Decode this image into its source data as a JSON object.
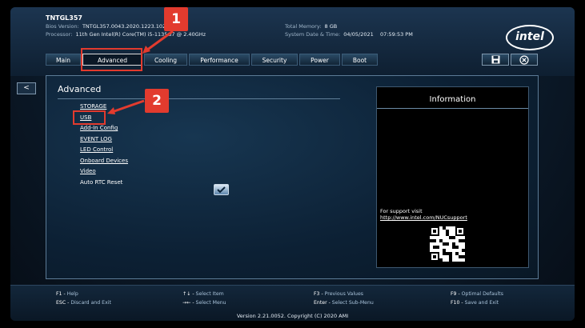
{
  "header": {
    "model": "TNTGL357",
    "bios_label": "Bios Version:",
    "bios_value": "TNTGL357.0043.2020.1223.1020",
    "processor_label": "Processor:",
    "processor_value": "11th Gen Intel(R) Core(TM) i5-1135G7 @ 2.40GHz",
    "memory_label": "Total Memory:",
    "memory_value": "8 GB",
    "datetime_label": "System Date & Time:",
    "date_value": "04/05/2021",
    "time_value": "07:59:53 PM",
    "logo_text": "intel"
  },
  "tabs": [
    {
      "label": "Main"
    },
    {
      "label": "Advanced"
    },
    {
      "label": "Cooling"
    },
    {
      "label": "Performance"
    },
    {
      "label": "Security"
    },
    {
      "label": "Power"
    },
    {
      "label": "Boot"
    }
  ],
  "toolbar": {
    "save_icon": "floppy-disk-icon",
    "exit_icon": "close-circle-icon",
    "back_label": "<"
  },
  "main": {
    "section_title": "Advanced",
    "items": [
      {
        "label": "STORAGE"
      },
      {
        "label": "USB"
      },
      {
        "label": "Add-In Config"
      },
      {
        "label": "EVENT LOG"
      },
      {
        "label": "LED Control"
      },
      {
        "label": "Onboard Devices"
      },
      {
        "label": "Video"
      },
      {
        "label": "Auto RTC Reset"
      }
    ],
    "auto_rtc_checked": true
  },
  "info": {
    "title": "Information",
    "support_text": "For support visit",
    "support_link": "http://www.intel.com/NUCsupport"
  },
  "footer": {
    "keys": [
      {
        "key": "F1",
        "desc": "Help"
      },
      {
        "key": "ESC",
        "desc": "Discard and Exit"
      },
      {
        "key": "↑↓",
        "desc": "Select Item"
      },
      {
        "key": "→←",
        "desc": "Select Menu"
      },
      {
        "key": "F3",
        "desc": "Previous Values"
      },
      {
        "key": "Enter",
        "desc": "Select Sub-Menu"
      },
      {
        "key": "F9",
        "desc": "Optimal Defaults"
      },
      {
        "key": "F10",
        "desc": "Save and Exit"
      }
    ],
    "copyright": "Version 2.21.0052. Copyright (C) 2020 AMI"
  },
  "annotations": [
    {
      "label": "1"
    },
    {
      "label": "2"
    }
  ],
  "colors": {
    "annotation": "#e23b2e",
    "background": "#0c1b2b"
  }
}
